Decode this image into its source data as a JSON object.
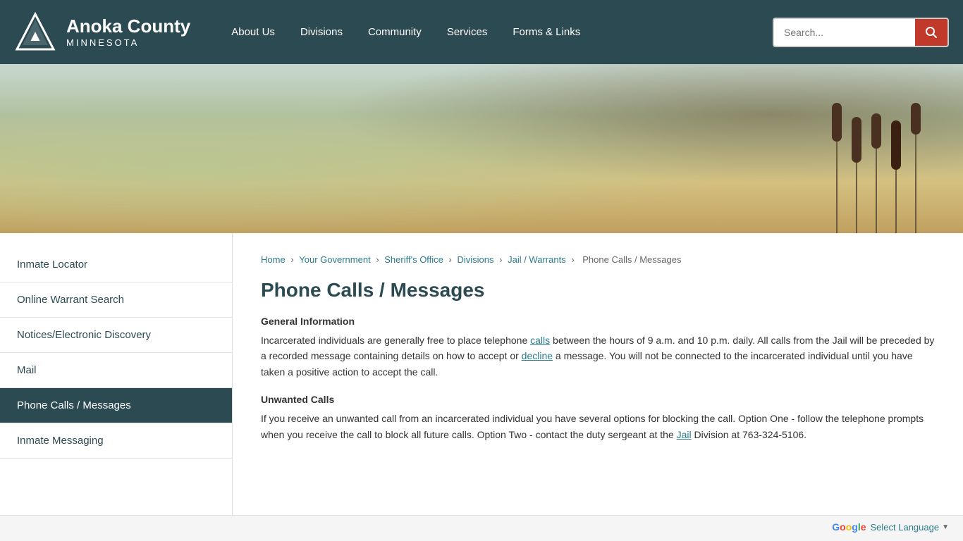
{
  "header": {
    "logo": {
      "county": "Anoka County",
      "state": "MINNESOTA"
    },
    "nav": [
      {
        "id": "about-us",
        "label": "About Us"
      },
      {
        "id": "divisions",
        "label": "Divisions"
      },
      {
        "id": "community",
        "label": "Community"
      },
      {
        "id": "services",
        "label": "Services"
      },
      {
        "id": "forms-links",
        "label": "Forms & Links"
      }
    ],
    "search": {
      "placeholder": "Search...",
      "button_label": "🔍"
    }
  },
  "sidebar": {
    "items": [
      {
        "id": "inmate-locator",
        "label": "Inmate Locator",
        "active": false
      },
      {
        "id": "online-warrant-search",
        "label": "Online Warrant Search",
        "active": false
      },
      {
        "id": "notices-electronic-discovery",
        "label": "Notices/Electronic Discovery",
        "active": false
      },
      {
        "id": "mail",
        "label": "Mail",
        "active": false
      },
      {
        "id": "phone-calls-messages",
        "label": "Phone Calls / Messages",
        "active": true
      },
      {
        "id": "inmate-messaging",
        "label": "Inmate Messaging",
        "active": false
      }
    ]
  },
  "breadcrumb": {
    "items": [
      {
        "label": "Home",
        "href": "#"
      },
      {
        "label": "Your Government",
        "href": "#"
      },
      {
        "label": "Sheriff's Office",
        "href": "#"
      },
      {
        "label": "Divisions",
        "href": "#"
      },
      {
        "label": "Jail / Warrants",
        "href": "#"
      },
      {
        "label": "Phone Calls / Messages",
        "href": "#",
        "current": true
      }
    ]
  },
  "main": {
    "title": "Phone Calls / Messages",
    "sections": [
      {
        "id": "general-info",
        "heading": "General Information",
        "body": "Incarcerated individuals are generally free to place telephone calls between the hours of 9 a.m. and 10 p.m. daily. All calls from the Jail will be preceded by a recorded message containing details on how to accept or decline a message. You will not be connected to the incarcerated individual until you have taken a positive action to accept the call."
      },
      {
        "id": "unwanted-calls",
        "heading": "Unwanted Calls",
        "body": "If you receive an unwanted call from an incarcerated individual you have several options for blocking the call. Option One - follow the telephone prompts when you receive the call to block all future calls. Option Two - contact the duty sergeant at the Jail Division at 763-324-5106."
      }
    ]
  },
  "footer": {
    "select_language_label": "Select Language",
    "google_g": "G"
  }
}
